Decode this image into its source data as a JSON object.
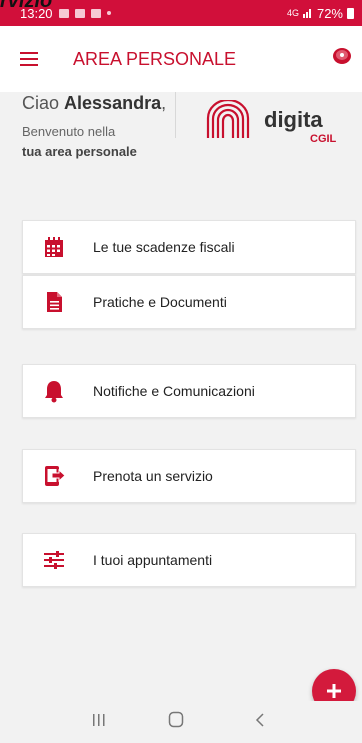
{
  "overlay": {
    "text": "rvizio"
  },
  "status_bar": {
    "time": "13:20",
    "signal": "4G",
    "battery": "72%"
  },
  "appbar": {
    "title": "AREA PERSONALE",
    "accent": "#c8102e"
  },
  "welcome": {
    "greeting_prefix": "Ciao ",
    "name": "Alessandra",
    "greeting_suffix": ",",
    "line1": "Benvenuto nella",
    "line2": "tua area personale"
  },
  "logo": {
    "text": "digita",
    "sub": "CGIL"
  },
  "menu": {
    "items": [
      {
        "label": "Le tue scadenze fiscali",
        "icon": "calendar-icon"
      },
      {
        "label": "Pratiche e Documenti",
        "icon": "document-icon"
      },
      {
        "label": "Notifiche e Comunicazioni",
        "icon": "bell-icon"
      },
      {
        "label": "Prenota un servizio",
        "icon": "phone-booking-icon"
      },
      {
        "label": "I tuoi appuntamenti",
        "icon": "sliders-icon"
      }
    ]
  },
  "fab": {
    "icon": "plus-icon"
  },
  "colors": {
    "brand": "#d10f3a",
    "background": "#f2f2f2"
  }
}
